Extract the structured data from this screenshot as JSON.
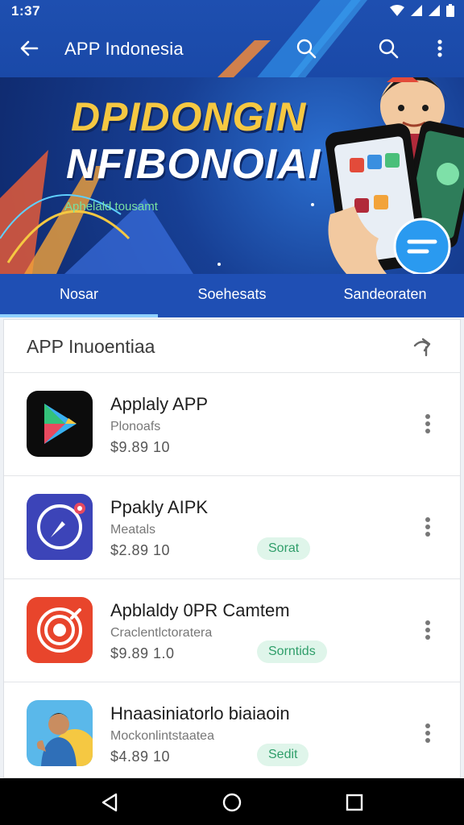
{
  "status": {
    "time": "1:37"
  },
  "appbar": {
    "title": "APP Indonesia",
    "icons": [
      "arrow-back-icon",
      "search-icon",
      "search-icon",
      "more-vert-icon"
    ]
  },
  "banner": {
    "headline1": "DPIDONGIN",
    "headline2": "NFIBONOIAI",
    "subline": "Aphelald tousamt"
  },
  "tabs": [
    {
      "label": "Nosar",
      "active": true
    },
    {
      "label": "Soehesats",
      "active": false
    },
    {
      "label": "Sandeoraten",
      "active": false
    }
  ],
  "list": {
    "title": "APP Inuoentiaa",
    "items": [
      {
        "name": "Applaly APP",
        "sub": "Plonoafs",
        "price": "$9.89 10",
        "badge": "",
        "icon": "google-play-icon"
      },
      {
        "name": "Ppakly AIPK",
        "sub": "Meatals",
        "price": "$2.89 10",
        "badge": "Sorat",
        "icon": "compass-app-icon"
      },
      {
        "name": "Apblaldy 0PR Camtem",
        "sub": "Craclentlctoratera",
        "price": "$9.89 1.0",
        "badge": "Sorntids",
        "icon": "target-app-icon"
      },
      {
        "name": "Hnaasiniatorlo biaiaoin",
        "sub": "Mockonlintstaatea",
        "price": "$4.89 10",
        "badge": "Sedit",
        "icon": "person-app-icon"
      }
    ]
  },
  "colors": {
    "primary": "#1f4fb4",
    "accent_yellow": "#f5c842",
    "badge_green": "#2f9e6a"
  }
}
